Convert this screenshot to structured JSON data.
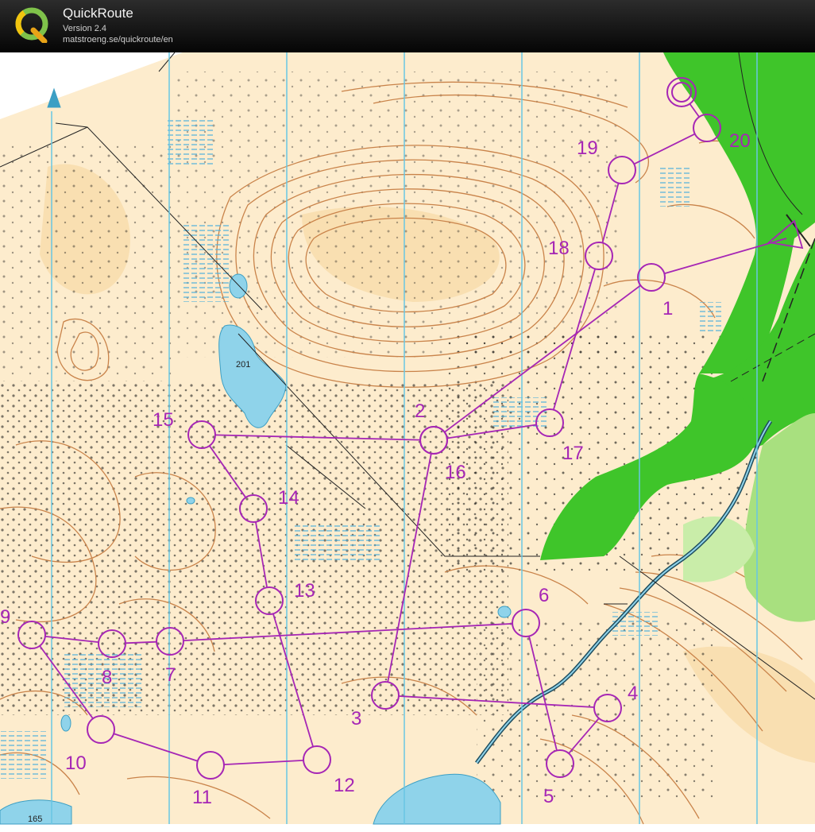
{
  "app": {
    "title": "QuickRoute",
    "version": "Version 2.4",
    "url": "matstroeng.se/quickroute/en",
    "logo_icon": "quickroute-q-logo-icon"
  },
  "map": {
    "spot_heights": [
      "201",
      "165"
    ],
    "colors": {
      "terrain": "#fdeccd",
      "contour": "#c9834a",
      "water": "#8fd3ea",
      "marsh": "#4fb0dc",
      "forest_green": "#3fc52a",
      "light_green": "#a8e07f",
      "north_lines": "#68c6e3",
      "course": "#a626b5",
      "header_bg": "#0b0b0b"
    }
  },
  "course": {
    "controls": [
      {
        "label": "1"
      },
      {
        "label": "2"
      },
      {
        "label": "3"
      },
      {
        "label": "4"
      },
      {
        "label": "5"
      },
      {
        "label": "6"
      },
      {
        "label": "7"
      },
      {
        "label": "8"
      },
      {
        "label": "9"
      },
      {
        "label": "10"
      },
      {
        "label": "11"
      },
      {
        "label": "12"
      },
      {
        "label": "13"
      },
      {
        "label": "14"
      },
      {
        "label": "15"
      },
      {
        "label": "16"
      },
      {
        "label": "17"
      },
      {
        "label": "18"
      },
      {
        "label": "19"
      },
      {
        "label": "20"
      }
    ]
  }
}
